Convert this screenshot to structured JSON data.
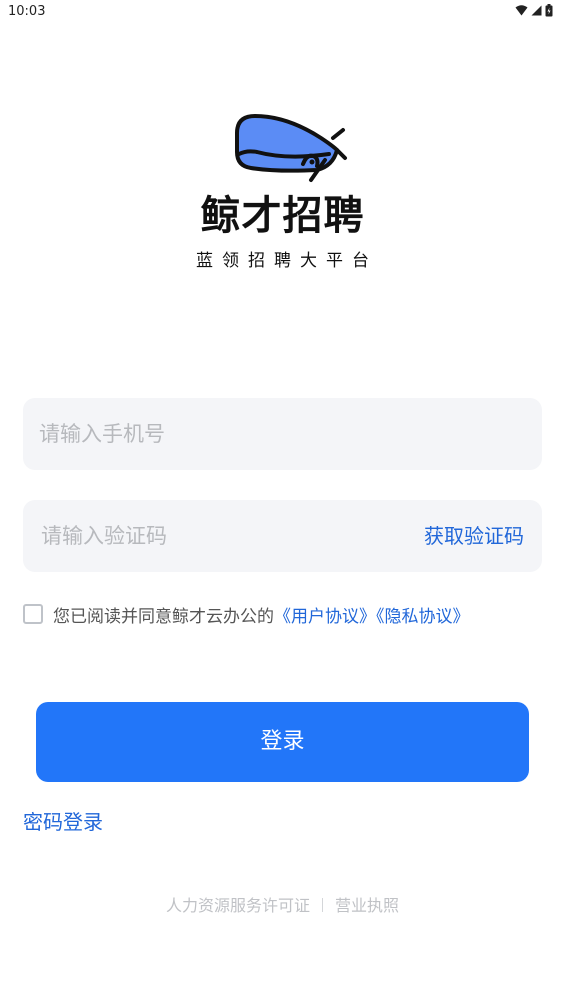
{
  "status_bar": {
    "time": "10:03"
  },
  "brand": {
    "name": "鲸才招聘",
    "tagline": "蓝领招聘大平台"
  },
  "phone_field": {
    "placeholder": "请输入手机号",
    "value": ""
  },
  "code_field": {
    "placeholder": "请输入验证码",
    "value": "",
    "get_code_label": "获取验证码"
  },
  "agreement": {
    "checked": false,
    "text": "您已阅读并同意鲸才云办公的",
    "user_agreement": "《用户协议》",
    "privacy_agreement": "《隐私协议》"
  },
  "login_button": {
    "label": "登录"
  },
  "password_login": {
    "label": "密码登录"
  },
  "footer": {
    "license": "人力资源服务许可证",
    "business_license": "营业执照"
  },
  "colors": {
    "accent": "#2276f9",
    "link": "#2167d9",
    "field_bg": "#f4f5f8",
    "logo_blue": "#5b8cf5"
  }
}
